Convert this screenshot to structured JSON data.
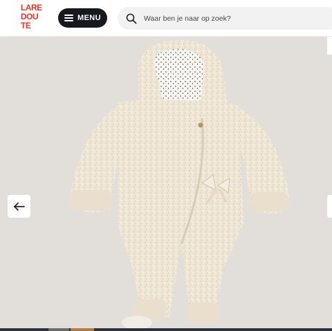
{
  "brand": {
    "logo_lines": [
      "LARE",
      "DOU",
      "TE"
    ],
    "logo_color": "#e8352a"
  },
  "header": {
    "menu_label": "MENU",
    "menu_icon": "hamburger-icon",
    "search": {
      "icon": "search-icon",
      "placeholder": "Waar ben je naar op zoek?"
    }
  },
  "gallery": {
    "image": "cream teddy-fleece hooded baby pramsuit",
    "prev_icon": "arrow-left-icon",
    "next_icon": "arrow-right-icon",
    "background": "#e2dfda"
  }
}
